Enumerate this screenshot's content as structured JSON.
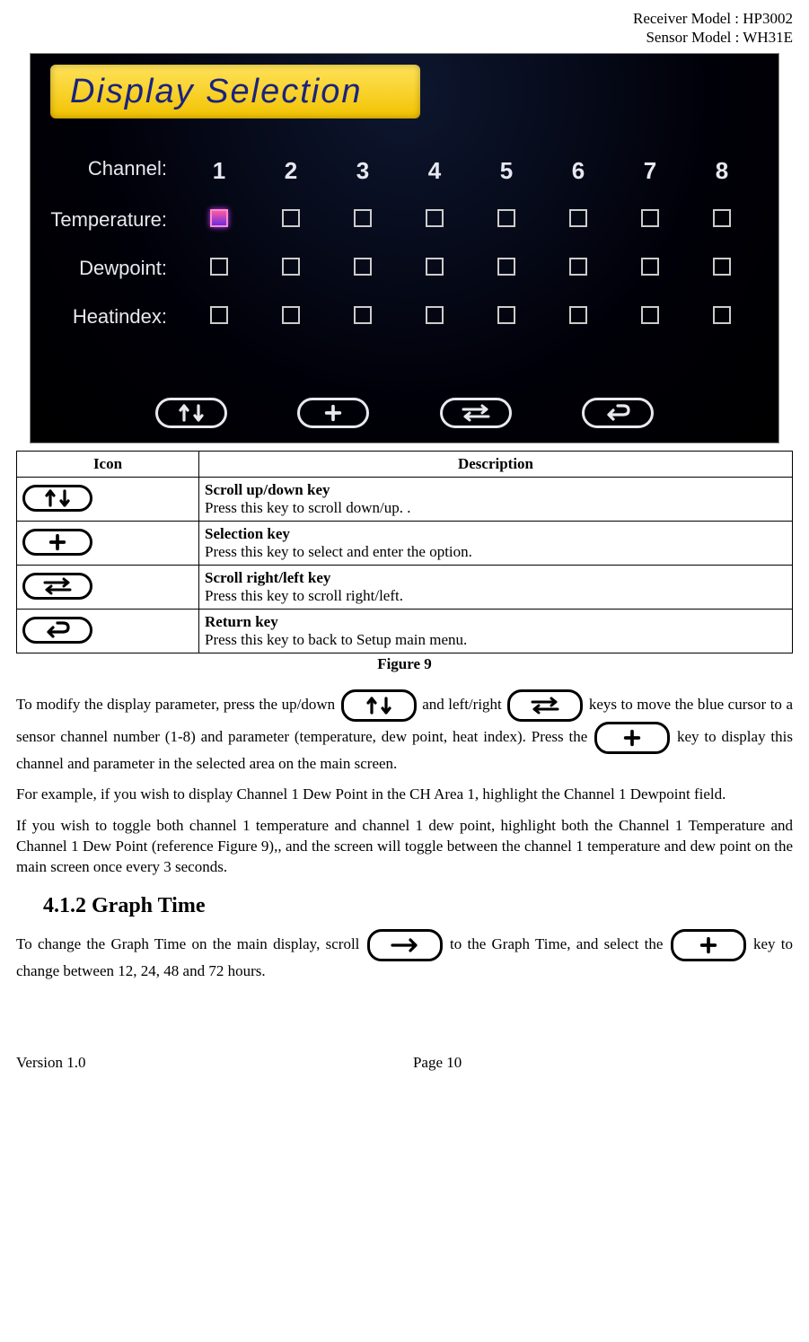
{
  "header": {
    "receiver_line": "Receiver Model : HP3002",
    "sensor_line": "Sensor Model : WH31E"
  },
  "device": {
    "banner": "Display  Selection",
    "row_labels": {
      "channel": "Channel:",
      "temperature": "Temperature:",
      "dewpoint": "Dewpoint:",
      "heatindex": "Heatindex:"
    },
    "channels": [
      "1",
      "2",
      "3",
      "4",
      "5",
      "6",
      "7",
      "8"
    ],
    "selected": {
      "row": "temperature",
      "col": 0
    }
  },
  "table": {
    "head_icon": "Icon",
    "head_desc": "Description",
    "rows": [
      {
        "title": "Scroll up/down key",
        "text": "Press this key to scroll down/up.    ."
      },
      {
        "title": "Selection key",
        "text": "Press this key to select and enter the option."
      },
      {
        "title": "Scroll right/left key",
        "text": "Press this key to scroll right/left."
      },
      {
        "title": "Return key",
        "text": "Press this key to back to Setup main menu."
      }
    ],
    "caption": "Figure 9"
  },
  "body": {
    "p1_a": "To modify the display parameter, press the up/down ",
    "p1_b": " and left/right ",
    "p1_c": " keys to move the blue cursor to a sensor channel number (1-8) and parameter (temperature, dew point, heat index). Press the ",
    "p1_d": " key to display this channel and parameter in the selected area on the main screen.",
    "p2": "For example, if you wish to display Channel 1 Dew Point in the CH Area 1, highlight the Channel 1 Dewpoint field.",
    "p3": "If you wish to toggle both channel 1 temperature and channel 1 dew point, highlight both the Channel 1 Temperature and Channel 1 Dew Point (reference Figure 9),, and the screen will toggle between the channel 1 temperature and dew point on the main screen once every 3 seconds.",
    "section_heading": "4.1.2  Graph Time",
    "p4_a": "To change the Graph Time on the main display, scroll ",
    "p4_b": " to the Graph Time, and select the ",
    "p4_c": " key to change between 12, 24, 48 and 72 hours."
  },
  "footer": {
    "version": "Version 1.0",
    "page": "Page 10"
  }
}
